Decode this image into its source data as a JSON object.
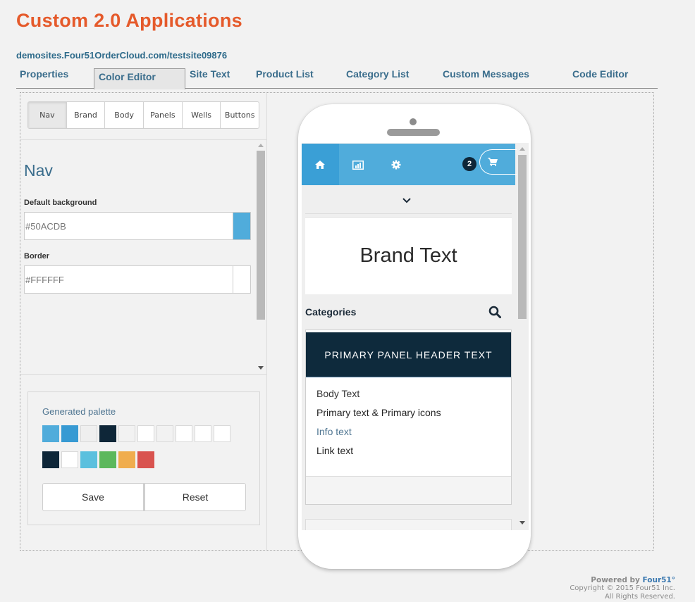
{
  "header": {
    "title": "Custom 2.0 Applications",
    "site_url": "demosites.Four51OrderCloud.com/testsite09876"
  },
  "tabs": [
    {
      "label": "Properties"
    },
    {
      "label": "Color Editor",
      "active": true
    },
    {
      "label": "Site Text"
    },
    {
      "label": "Product List"
    },
    {
      "label": "Category List"
    },
    {
      "label": "Custom Messages"
    },
    {
      "label": "Code Editor"
    }
  ],
  "editor": {
    "segments": [
      "Nav",
      "Brand",
      "Body",
      "Panels",
      "Wells",
      "Buttons"
    ],
    "active_segment": "Nav",
    "section_title": "Nav",
    "fields": [
      {
        "label": "Default background",
        "value": "#50ACDB",
        "swatch": "#50ACDB"
      },
      {
        "label": "Border",
        "value": "#FFFFFF",
        "swatch": "#FFFFFF"
      }
    ]
  },
  "palette": {
    "title": "Generated palette",
    "row1": [
      "#50ACDB",
      "#379AD3",
      "#EFEFEF",
      "#0E2638",
      "#F2F2F2",
      "#FFFFFF",
      "#F2F2F2",
      "#FFFFFF",
      "#FFFFFF",
      "#FFFFFF"
    ],
    "row2": [
      "#0E2638",
      "#FFFFFF",
      "#5BC0DE",
      "#5CB85C",
      "#F0AD4E",
      "#D9534F"
    ],
    "save_label": "Save",
    "reset_label": "Reset"
  },
  "preview": {
    "cart_count": "2",
    "brand_text": "Brand Text",
    "categories_label": "Categories",
    "panel_header": "PRIMARY PANEL HEADER TEXT",
    "body_text": "Body Text",
    "primary_text": "Primary text & Primary icons",
    "info_text": "Info text",
    "link_text": "Link text",
    "colors": {
      "nav_bg": "#50ACDB",
      "nav_active": "#3A9FD6",
      "panel_header_bg": "#0E2A3C",
      "info_text": "#4F7591"
    }
  },
  "footer": {
    "powered_by": "Powered by",
    "brand": "Four51°",
    "copyright": "Copyright © 2015 Four51 Inc.",
    "rights": "All Rights Reserved."
  }
}
